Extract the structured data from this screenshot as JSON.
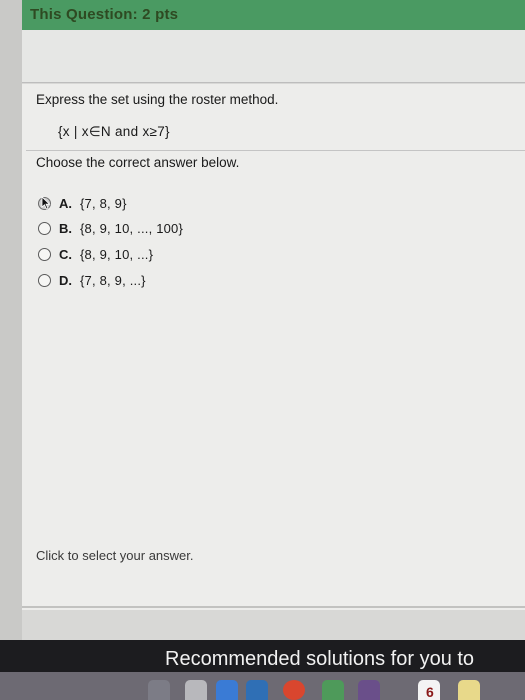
{
  "header": {
    "title": "This Question: 2 pts"
  },
  "question": {
    "prompt": "Express the set using the roster method.",
    "set_expression": "{x | x∈N  and  x≥7}",
    "choose_label": "Choose the correct answer below."
  },
  "options": [
    {
      "letter": "A.",
      "value": "{7, 8, 9}",
      "selected": true
    },
    {
      "letter": "B.",
      "value": "{8, 9, 10, ..., 100}",
      "selected": false
    },
    {
      "letter": "C.",
      "value": "{8, 9, 10, ...}",
      "selected": false
    },
    {
      "letter": "D.",
      "value": "{7, 8, 9, ...}",
      "selected": false
    }
  ],
  "footer": {
    "hint": "Click to select your answer."
  },
  "overlay": {
    "recommended": "Recommended solutions for you to"
  },
  "dock": {
    "calendar_day": "6",
    "icons": [
      "launchpad-icon",
      "rocket-icon",
      "safari-icon",
      "chrome-icon",
      "maps-icon",
      "music-icon",
      "calendar-icon",
      "notes-icon"
    ]
  }
}
